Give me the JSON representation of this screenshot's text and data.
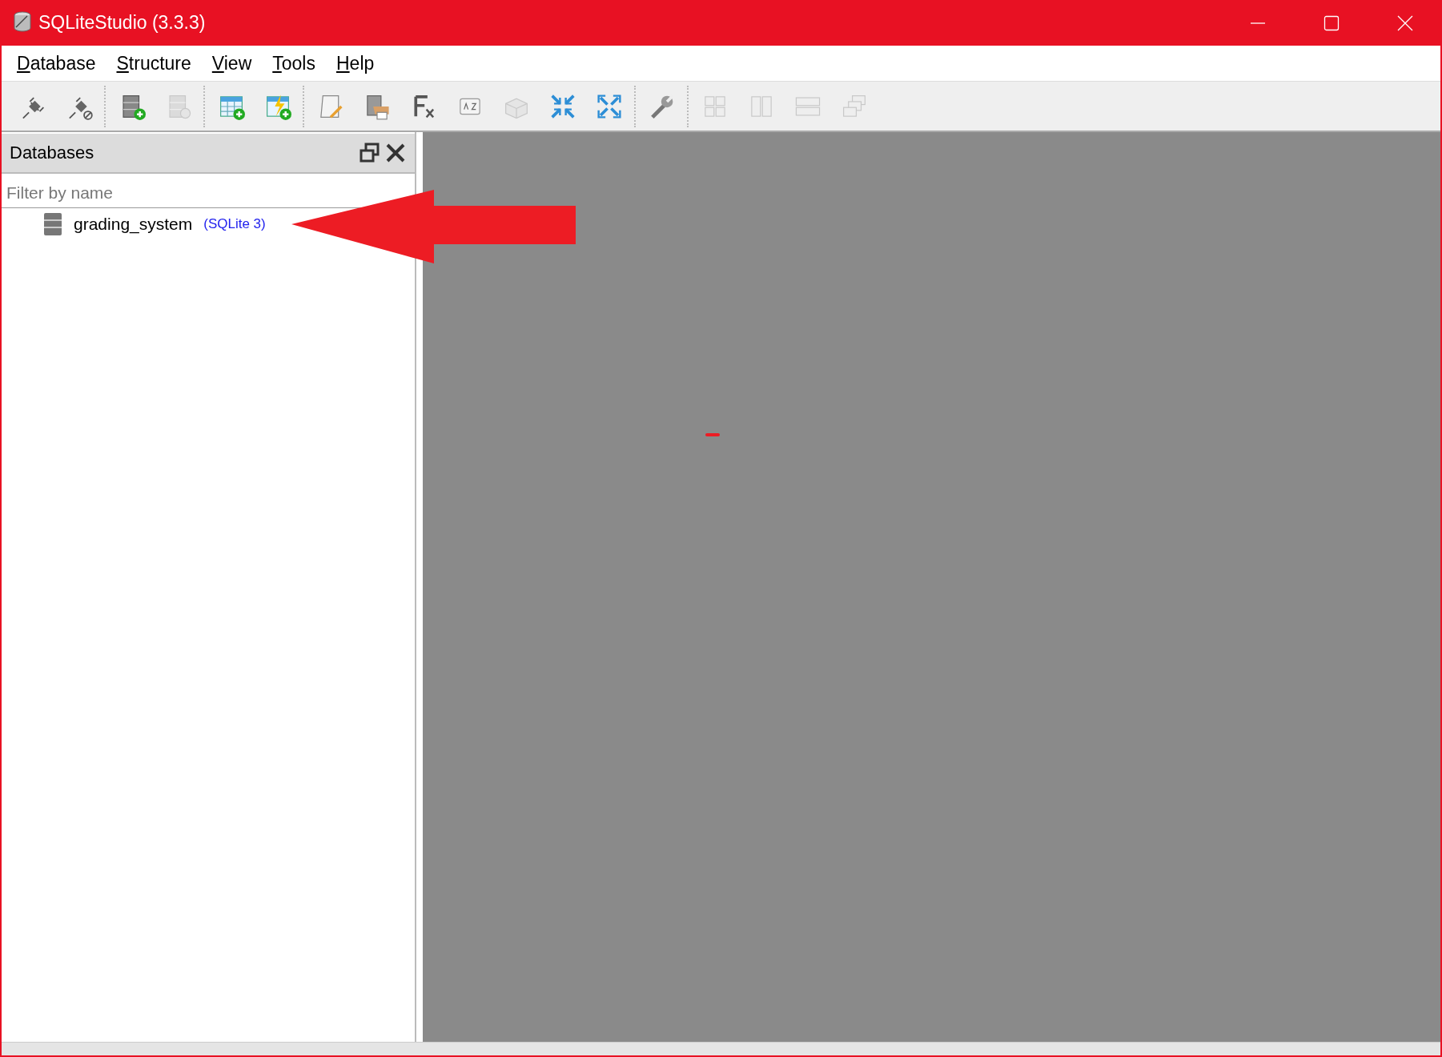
{
  "window": {
    "title": "SQLiteStudio (3.3.3)"
  },
  "menu": [
    {
      "label": "Database"
    },
    {
      "label": "Structure"
    },
    {
      "label": "View"
    },
    {
      "label": "Tools"
    },
    {
      "label": "Help"
    }
  ],
  "toolbar": [
    {
      "buttons": [
        {
          "kind": "connect",
          "disabled": false
        },
        {
          "kind": "disconnect",
          "disabled": false
        }
      ]
    },
    {
      "buttons": [
        {
          "kind": "db-add",
          "disabled": false
        },
        {
          "kind": "db-edit",
          "disabled": true
        }
      ]
    },
    {
      "buttons": [
        {
          "kind": "table-add",
          "disabled": false
        },
        {
          "kind": "table-flash",
          "disabled": false
        }
      ]
    },
    {
      "buttons": [
        {
          "kind": "sql-editor",
          "disabled": false
        },
        {
          "kind": "ddl-history",
          "disabled": false
        },
        {
          "kind": "functions",
          "disabled": false
        },
        {
          "kind": "collations",
          "disabled": false
        },
        {
          "kind": "extensions",
          "disabled": true
        },
        {
          "kind": "collapse",
          "disabled": false
        },
        {
          "kind": "expand",
          "disabled": false
        }
      ]
    },
    {
      "buttons": [
        {
          "kind": "settings",
          "disabled": false
        }
      ]
    },
    {
      "buttons": [
        {
          "kind": "tile",
          "disabled": true
        },
        {
          "kind": "tile-h",
          "disabled": true
        },
        {
          "kind": "tile-v",
          "disabled": true
        },
        {
          "kind": "cascade",
          "disabled": true
        }
      ]
    }
  ],
  "databases_panel": {
    "title": "Databases",
    "filter": {
      "placeholder": "Filter by name"
    },
    "items": [
      {
        "name": "grading_system",
        "type": "(SQLite 3)"
      }
    ]
  }
}
